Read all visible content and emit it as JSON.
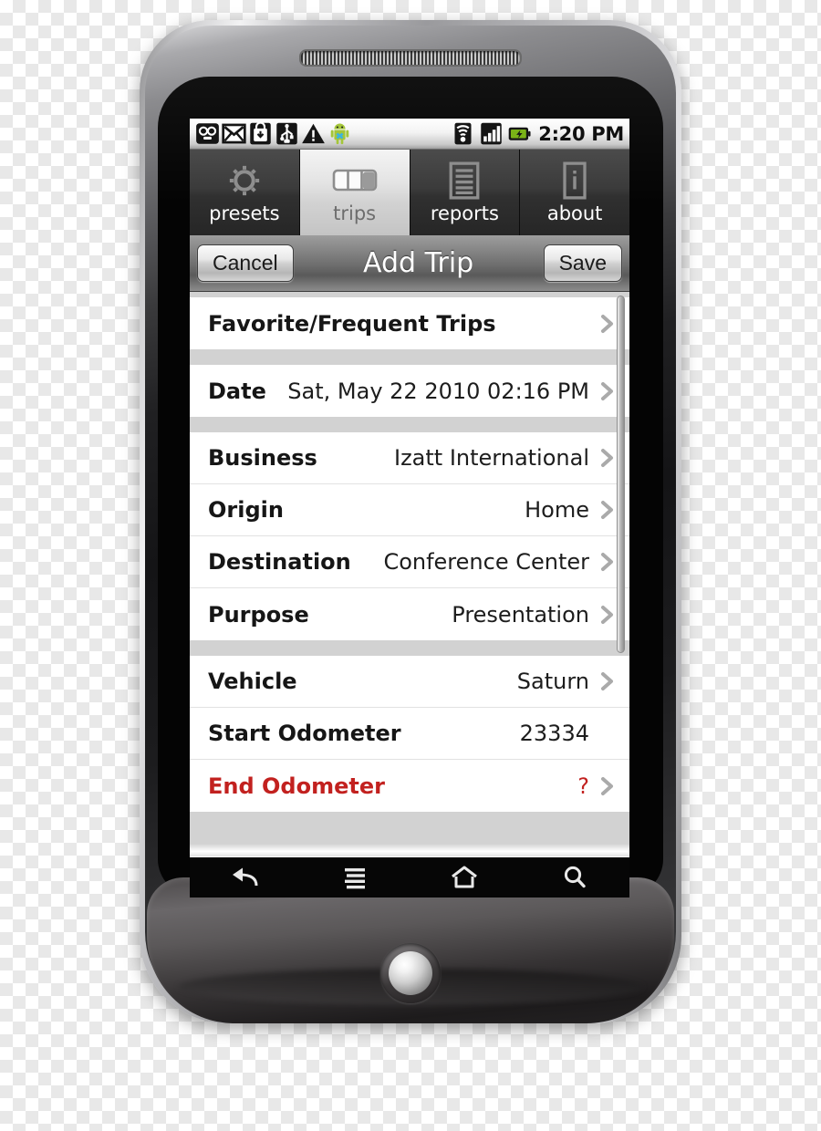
{
  "device": {
    "name": "android-smartphone",
    "button": "trackball"
  },
  "status_bar": {
    "time": "2:20 PM",
    "left_icons": [
      "voicemail-icon",
      "gmail-icon",
      "download-market-icon",
      "usb-icon",
      "warning-icon",
      "android-robot-icon"
    ],
    "right_icons": [
      "wifi-icon",
      "signal-bars-icon",
      "battery-charging-icon"
    ]
  },
  "tabs": [
    {
      "label": "presets",
      "icon": "gear-icon",
      "selected": false
    },
    {
      "label": "trips",
      "icon": "trips-segments-icon",
      "selected": true
    },
    {
      "label": "reports",
      "icon": "document-lines-icon",
      "selected": false
    },
    {
      "label": "about",
      "icon": "info-box-icon",
      "selected": false
    }
  ],
  "title_bar": {
    "cancel_label": "Cancel",
    "title": "Add Trip",
    "save_label": "Save"
  },
  "form": {
    "groups": [
      {
        "rows": [
          {
            "label": "Favorite/Frequent Trips",
            "value": "",
            "chevron": true,
            "alert": false
          }
        ]
      },
      {
        "rows": [
          {
            "label": "Date",
            "value": "Sat, May 22 2010 02:16 PM",
            "chevron": true,
            "alert": false
          }
        ]
      },
      {
        "rows": [
          {
            "label": "Business",
            "value": "Izatt International",
            "chevron": true,
            "alert": false
          },
          {
            "label": "Origin",
            "value": "Home",
            "chevron": true,
            "alert": false
          },
          {
            "label": "Destination",
            "value": "Conference Center",
            "chevron": true,
            "alert": false
          },
          {
            "label": "Purpose",
            "value": "Presentation",
            "chevron": true,
            "alert": false
          }
        ]
      },
      {
        "rows": [
          {
            "label": "Vehicle",
            "value": "Saturn",
            "chevron": true,
            "alert": false
          },
          {
            "label": "Start Odometer",
            "value": "23334",
            "chevron": false,
            "alert": false
          },
          {
            "label": "End Odometer",
            "value": "?",
            "chevron": true,
            "alert": true
          }
        ]
      }
    ]
  },
  "nav_bar": {
    "buttons": [
      "back-icon",
      "menu-icon",
      "home-icon",
      "search-icon"
    ]
  },
  "colors": {
    "alert_red": "#c2211f",
    "list_background": "#d2d2d2",
    "row_background": "#ffffff",
    "tab_selected_text": "#6d6d6d",
    "battery_green": "#7ab317"
  }
}
